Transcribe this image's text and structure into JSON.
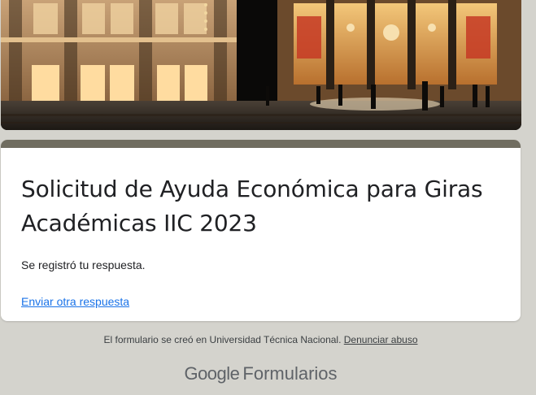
{
  "header": {
    "image_description": "banner-photo"
  },
  "card": {
    "title": "Solicitud de Ayuda Económica para Giras Académicas IIC 2023",
    "confirmation": "Se registró tu respuesta.",
    "another_response_link": "Enviar otra respuesta",
    "accent_color": "#706d60"
  },
  "footer": {
    "created_text": "El formulario se creó en Universidad Técnica Nacional.",
    "report_abuse_link": "Denunciar abuso",
    "brand_google": "Google",
    "brand_product": "Formularios"
  },
  "colors": {
    "background": "#d4d3cd",
    "link": "#1a73e8",
    "text": "#202124"
  }
}
